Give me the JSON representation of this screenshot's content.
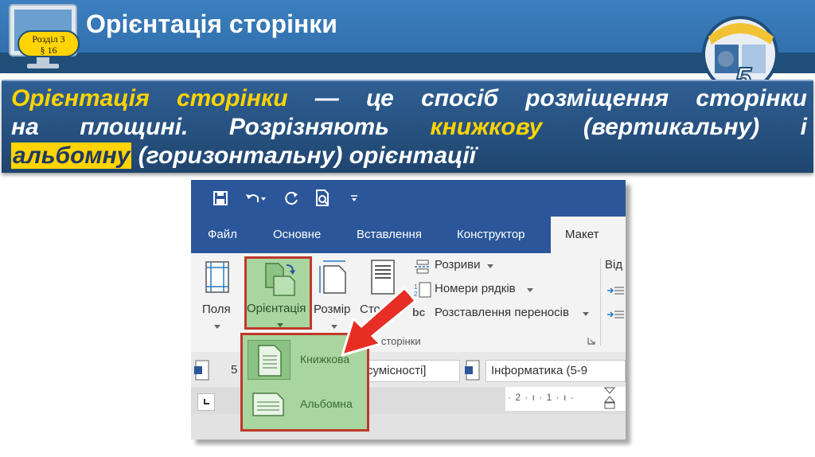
{
  "slide": {
    "title": "Орієнтація сторінки",
    "badge_line1": "Розділ 3",
    "badge_line2": "§ 16",
    "logo_number": "5"
  },
  "definition": {
    "term": "Орієнтація сторінки",
    "part1": " — це спосіб розміщення сторінки",
    "part2": "на площині. Розрізняють ",
    "portrait_term": "книжкову",
    "part3": " (вертикальну) і",
    "landscape_term": "альбомну",
    "part4": " (горизонтальну) орієнтації"
  },
  "word": {
    "tabs": [
      {
        "label": "Файл"
      },
      {
        "label": "Основне"
      },
      {
        "label": "Вставлення"
      },
      {
        "label": "Конструктор"
      },
      {
        "label": "Макет"
      }
    ],
    "ribbon": {
      "margins_label": "Поля",
      "orientation_label": "Орієнтація",
      "size_label": "Розмір",
      "columns_label": "Стовпці",
      "breaks_label": "Розриви",
      "line_numbers_label": "Номери рядків",
      "hyphenation_label": "Розставлення переносів",
      "group_label": "Параметри сторінки",
      "indent_label": "Від",
      "hyphen_icon_text": "bc"
    },
    "dropdown": {
      "portrait": "Книжкова",
      "landscape": "Альбомна"
    },
    "docbar": {
      "field1": "5",
      "field2": "сумісності]",
      "field3": "Інформатика (5-9"
    },
    "ruler_text": "· 2 · ı · 1 · ı ·"
  },
  "colors": {
    "header": "#2e6aa6",
    "word_blue": "#2b579a",
    "highlight": "#ffd400",
    "accent_red": "#c0392b",
    "green": "#a8d5a0"
  }
}
